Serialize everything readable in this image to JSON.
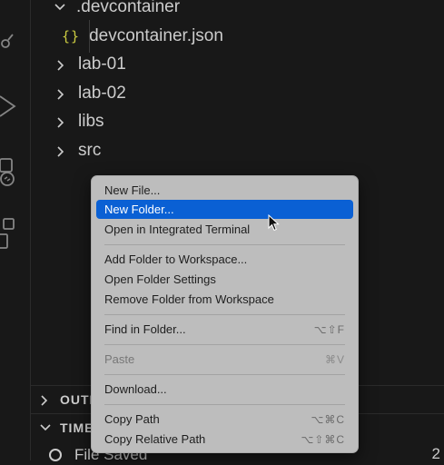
{
  "explorer": {
    "items": [
      {
        "label": ".devcontainer",
        "type": "folder",
        "expanded": true
      },
      {
        "label": "devcontainer.json",
        "type": "file",
        "icon": "json-braces-icon",
        "icon_text": "{}"
      },
      {
        "label": "lab-01",
        "type": "folder",
        "expanded": false
      },
      {
        "label": "lab-02",
        "type": "folder",
        "expanded": false
      },
      {
        "label": "libs",
        "type": "folder",
        "expanded": false
      },
      {
        "label": "src",
        "type": "folder",
        "expanded": false
      }
    ]
  },
  "panels": {
    "outline": {
      "label": "OUTLINE",
      "visible_text": "OUTL",
      "expanded": false
    },
    "timeline": {
      "label": "TIMELINE",
      "visible_text": "TIME",
      "expanded": true
    },
    "timeline_item": {
      "label": "File Saved",
      "right_text": "2"
    }
  },
  "context_menu": {
    "items": [
      {
        "label": "New File...",
        "shortcut": ""
      },
      {
        "label": "New Folder...",
        "shortcut": "",
        "selected": true
      },
      {
        "label": "Open in Integrated Terminal",
        "shortcut": ""
      },
      {
        "label": "Add Folder to Workspace...",
        "shortcut": ""
      },
      {
        "label": "Open Folder Settings",
        "shortcut": ""
      },
      {
        "label": "Remove Folder from Workspace",
        "shortcut": ""
      },
      {
        "label": "Find in Folder...",
        "shortcut": "⌥⇧F"
      },
      {
        "label": "Paste",
        "shortcut": "⌘V",
        "disabled": true
      },
      {
        "label": "Download...",
        "shortcut": ""
      },
      {
        "label": "Copy Path",
        "shortcut": "⌥⌘C"
      },
      {
        "label": "Copy Relative Path",
        "shortcut": "⌥⇧⌘C"
      }
    ]
  },
  "colors": {
    "background": "#181818",
    "menu_background": "#bdbdbd",
    "selection": "#0a60d4",
    "json_icon": "#cbcb41"
  }
}
